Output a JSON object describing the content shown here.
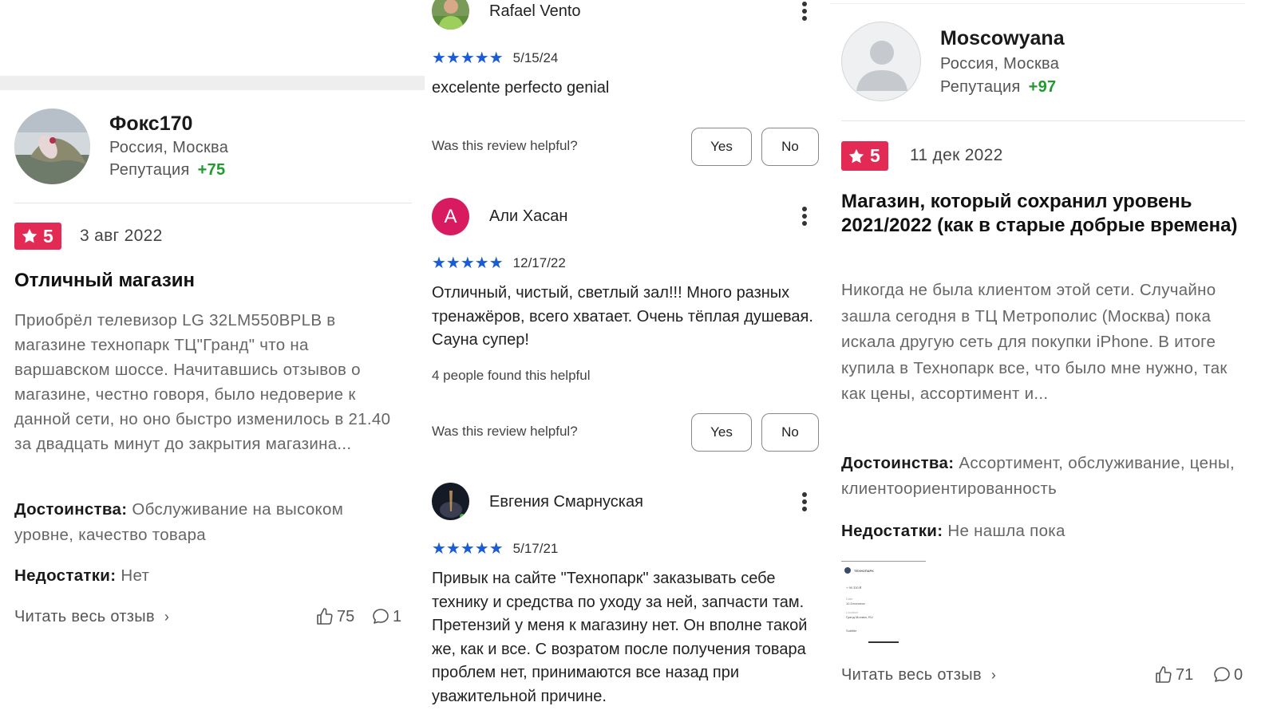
{
  "left_review": {
    "user": {
      "name": "Фокс170",
      "location": "Россия, Москва",
      "reputation_label": "Репутация",
      "reputation_value": "+75"
    },
    "rating": "5",
    "date": "3 авг 2022",
    "title": "Отличный магазин",
    "body": "Приобрёл телевизор LG 32LM550BPLB в магазине технопарк ТЦ\"Гранд\" что на варшавском шоссе. Начитавшись отзывов о магазине, честно говоря, было недоверие к данной сети, но оно быстро изменилось в 21.40 за двадцать минут до закрытия магазина...",
    "pros_label": "Достоинства:",
    "pros": "Обслуживание на высоком уровне, качество товара",
    "cons_label": "Недостатки:",
    "cons": "Нет",
    "read_more": "Читать весь отзыв",
    "likes": "75",
    "comments": "1"
  },
  "middle_reviews": [
    {
      "name": "Rafael Vento",
      "stars": "★★★★★",
      "date": "5/15/24",
      "text": "excelente perfecto genial",
      "helpful_question": "Was this review helpful?",
      "yes": "Yes",
      "no": "No"
    },
    {
      "name": "Али Хасан",
      "avatar_letter": "A",
      "avatar_color": "#d81b60",
      "stars": "★★★★★",
      "date": "12/17/22",
      "text": "Отличный, чистый, светлый зал!!! Много разных тренажёров, всего хватает. Очень тёплая душевая. Сауна супер!",
      "found_helpful": "4 people found this helpful",
      "helpful_question": "Was this review helpful?",
      "yes": "Yes",
      "no": "No"
    },
    {
      "name": "Евгения Смарнуская",
      "stars": "★★★★★",
      "date": "5/17/21",
      "text": "Привык на сайте \"Технопарк\" заказывать себе технику и средства по уходу за ней, запчасти там. Претензий у меня к магазину нет. Он вполне такой же, как и все. С возратом после получения товара проблем нет, принимаются все назад при уважительной причине."
    }
  ],
  "right_review": {
    "user": {
      "name": "Moscowyana",
      "location": "Россия, Москва",
      "reputation_label": "Репутация",
      "reputation_value": "+97"
    },
    "rating": "5",
    "date": "11 дек 2022",
    "title": "Магазин, который сохранил уровень 2021/2022 (как в старые добрые времена)",
    "body": "Никогда не была клиентом этой сети. Случайно зашла сегодня в ТЦ Метрополис (Москва) пока искала другую сеть для покупки iPhone. В итоге купила в Технопарк все, что было мне нужно, так как цены, ассортимент и...",
    "pros_label": "Достоинства:",
    "pros": "Ассортимент, обслуживание, цены, клиентоориентированность",
    "cons_label": "Недостатки:",
    "cons": "Не нашла пока",
    "attachment": {
      "brand": "ТЕХНОПАРК",
      "price": "+ 99 330 ₽",
      "date_label": "Date",
      "date": "10 December",
      "location_label": "Location",
      "location": "Гранд Москва, RU",
      "subtitle": "Subtitle"
    },
    "read_more": "Читать весь отзыв",
    "likes": "71",
    "comments": "0"
  },
  "colors": {
    "badge": "#e22a55",
    "reputation": "#1f9b2e",
    "stars": "#1a5cd6"
  }
}
